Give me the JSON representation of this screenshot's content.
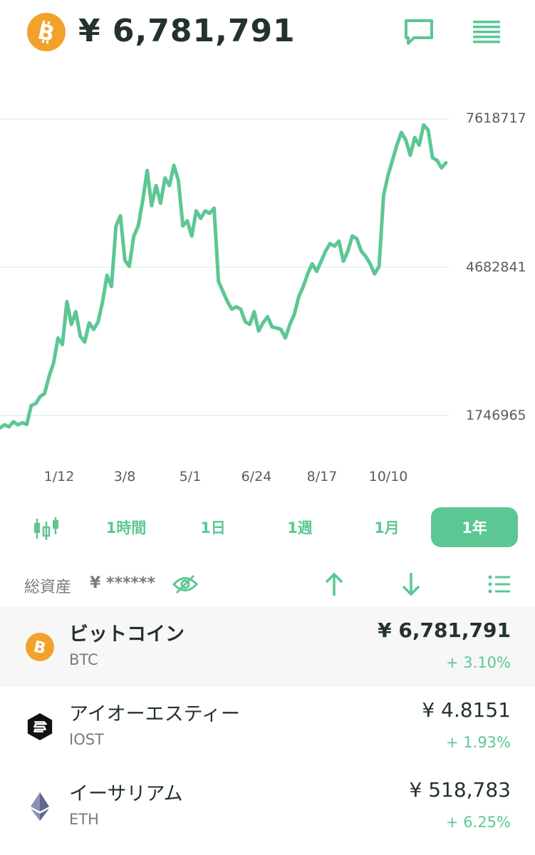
{
  "header": {
    "coin_icon": "bitcoin-icon",
    "price": "¥ 6,781,791",
    "chat_icon": "chat-bubble-icon",
    "menu_icon": "order-book-icon"
  },
  "colors": {
    "accent": "#5cc793",
    "bitcoin": "#f2a22b",
    "text": "#24322c",
    "muted": "#7a7a7a",
    "selected_row": "#f7f7f7"
  },
  "chart_data": {
    "type": "line",
    "y_ticks": [
      "7618717",
      "4682841",
      "1746965"
    ],
    "x_ticks": [
      "1/12",
      "3/8",
      "5/1",
      "6/24",
      "8/17",
      "10/10"
    ],
    "ylim": [
      1746965,
      7618717
    ],
    "grid": true,
    "series": [
      {
        "values": [
          1500000,
          1560000,
          1520000,
          1620000,
          1560000,
          1600000,
          1570000,
          1940000,
          1980000,
          2120000,
          2180000,
          2520000,
          2780000,
          3280000,
          3150000,
          4000000,
          3550000,
          3800000,
          3320000,
          3200000,
          3580000,
          3450000,
          3600000,
          4000000,
          4520000,
          4300000,
          5500000,
          5700000,
          4820000,
          4700000,
          5300000,
          5500000,
          6000000,
          6600000,
          5900000,
          6300000,
          5950000,
          6450000,
          6300000,
          6700000,
          6400000,
          5500000,
          5600000,
          5300000,
          5800000,
          5650000,
          5800000,
          5750000,
          5850000,
          4400000,
          4200000,
          4000000,
          3850000,
          3900000,
          3850000,
          3600000,
          3550000,
          3800000,
          3420000,
          3580000,
          3700000,
          3500000,
          3480000,
          3450000,
          3280000,
          3550000,
          3750000,
          4100000,
          4300000,
          4550000,
          4750000,
          4600000,
          4800000,
          5000000,
          5150000,
          5100000,
          5200000,
          4800000,
          5000000,
          5300000,
          5250000,
          5000000,
          4900000,
          4750000,
          4550000,
          4700000,
          6100000,
          6500000,
          6800000,
          7100000,
          7350000,
          7200000,
          6900000,
          7250000,
          7100000,
          7500000,
          7400000,
          6850000,
          6800000,
          6650000,
          6750000
        ]
      }
    ]
  },
  "ranges": {
    "candle_icon": "candlestick-icon",
    "items": [
      "1時間",
      "1日",
      "1週",
      "1月",
      "1年"
    ],
    "active": "1年"
  },
  "toolbar": {
    "total_label": "総資産",
    "total_value": "¥ ******",
    "hide_icon": "eye-off-icon",
    "sort_up_icon": "arrow-up-icon",
    "sort_down_icon": "arrow-down-icon",
    "list_icon": "list-icon"
  },
  "assets": [
    {
      "name": "ビットコイン",
      "symbol": "BTC",
      "price": "¥ 6,781,791",
      "change": "+ 3.10%",
      "icon": "bitcoin-icon"
    },
    {
      "name": "アイオーエスティー",
      "symbol": "IOST",
      "price": "¥ 4.8151",
      "change": "+ 1.93%",
      "icon": "iost-icon"
    },
    {
      "name": "イーサリアム",
      "symbol": "ETH",
      "price": "¥ 518,783",
      "change": "+ 6.25%",
      "icon": "ethereum-icon"
    }
  ]
}
